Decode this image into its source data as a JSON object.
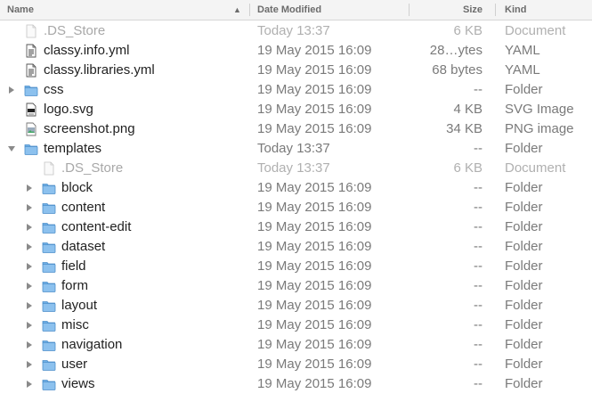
{
  "columns": {
    "name": "Name",
    "date_modified": "Date Modified",
    "size": "Size",
    "kind": "Kind"
  },
  "rows": [
    {
      "name": ".DS_Store",
      "date": "Today 13:37",
      "size": "6 KB",
      "kind": "Document",
      "icon": "document-icon",
      "level": 0,
      "disclosure": "none",
      "faded": true
    },
    {
      "name": "classy.info.yml",
      "date": "19 May 2015 16:09",
      "size": "28…ytes",
      "kind": "YAML",
      "icon": "text-file-icon",
      "level": 0,
      "disclosure": "none",
      "faded": false
    },
    {
      "name": "classy.libraries.yml",
      "date": "19 May 2015 16:09",
      "size": "68 bytes",
      "kind": "YAML",
      "icon": "text-file-icon",
      "level": 0,
      "disclosure": "none",
      "faded": false
    },
    {
      "name": "css",
      "date": "19 May 2015 16:09",
      "size": "--",
      "kind": "Folder",
      "icon": "folder-icon",
      "level": 0,
      "disclosure": "collapsed",
      "faded": false
    },
    {
      "name": "logo.svg",
      "date": "19 May 2015 16:09",
      "size": "4 KB",
      "kind": "SVG Image",
      "icon": "svg-file-icon",
      "level": 0,
      "disclosure": "none",
      "faded": false
    },
    {
      "name": "screenshot.png",
      "date": "19 May 2015 16:09",
      "size": "34 KB",
      "kind": "PNG image",
      "icon": "image-file-icon",
      "level": 0,
      "disclosure": "none",
      "faded": false
    },
    {
      "name": "templates",
      "date": "Today 13:37",
      "size": "--",
      "kind": "Folder",
      "icon": "folder-icon",
      "level": 0,
      "disclosure": "expanded",
      "faded": false
    },
    {
      "name": ".DS_Store",
      "date": "Today 13:37",
      "size": "6 KB",
      "kind": "Document",
      "icon": "document-icon",
      "level": 1,
      "disclosure": "none",
      "faded": true
    },
    {
      "name": "block",
      "date": "19 May 2015 16:09",
      "size": "--",
      "kind": "Folder",
      "icon": "folder-icon",
      "level": 1,
      "disclosure": "collapsed",
      "faded": false
    },
    {
      "name": "content",
      "date": "19 May 2015 16:09",
      "size": "--",
      "kind": "Folder",
      "icon": "folder-icon",
      "level": 1,
      "disclosure": "collapsed",
      "faded": false
    },
    {
      "name": "content-edit",
      "date": "19 May 2015 16:09",
      "size": "--",
      "kind": "Folder",
      "icon": "folder-icon",
      "level": 1,
      "disclosure": "collapsed",
      "faded": false
    },
    {
      "name": "dataset",
      "date": "19 May 2015 16:09",
      "size": "--",
      "kind": "Folder",
      "icon": "folder-icon",
      "level": 1,
      "disclosure": "collapsed",
      "faded": false
    },
    {
      "name": "field",
      "date": "19 May 2015 16:09",
      "size": "--",
      "kind": "Folder",
      "icon": "folder-icon",
      "level": 1,
      "disclosure": "collapsed",
      "faded": false
    },
    {
      "name": "form",
      "date": "19 May 2015 16:09",
      "size": "--",
      "kind": "Folder",
      "icon": "folder-icon",
      "level": 1,
      "disclosure": "collapsed",
      "faded": false
    },
    {
      "name": "layout",
      "date": "19 May 2015 16:09",
      "size": "--",
      "kind": "Folder",
      "icon": "folder-icon",
      "level": 1,
      "disclosure": "collapsed",
      "faded": false
    },
    {
      "name": "misc",
      "date": "19 May 2015 16:09",
      "size": "--",
      "kind": "Folder",
      "icon": "folder-icon",
      "level": 1,
      "disclosure": "collapsed",
      "faded": false
    },
    {
      "name": "navigation",
      "date": "19 May 2015 16:09",
      "size": "--",
      "kind": "Folder",
      "icon": "folder-icon",
      "level": 1,
      "disclosure": "collapsed",
      "faded": false
    },
    {
      "name": "user",
      "date": "19 May 2015 16:09",
      "size": "--",
      "kind": "Folder",
      "icon": "folder-icon",
      "level": 1,
      "disclosure": "collapsed",
      "faded": false
    },
    {
      "name": "views",
      "date": "19 May 2015 16:09",
      "size": "--",
      "kind": "Folder",
      "icon": "folder-icon",
      "level": 1,
      "disclosure": "collapsed",
      "faded": false
    }
  ],
  "colors": {
    "folder_fill": "#8cc1ee",
    "folder_tab": "#6fb0e6",
    "folder_stroke": "#4d8fca",
    "disclosure": "#8a8a8a",
    "faded_text": "#a8a8a8"
  }
}
